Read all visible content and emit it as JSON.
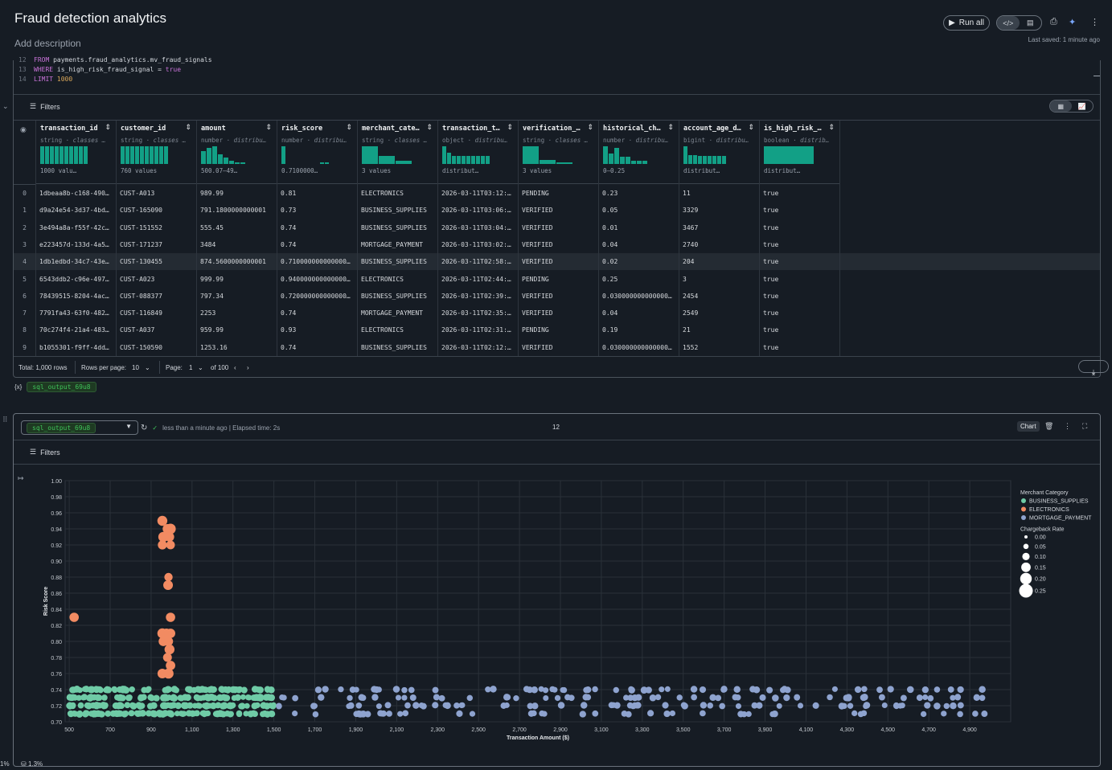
{
  "header": {
    "title": "Fraud detection analytics",
    "description": "Add description",
    "run_all": "Run all",
    "last_saved": "Last saved: 1 minute ago"
  },
  "code": {
    "lines": [
      {
        "n": "12",
        "parts": [
          [
            "kw",
            "FROM "
          ],
          [
            "",
            "payments.fraud_analytics.mv_fraud_signals"
          ]
        ]
      },
      {
        "n": "13",
        "parts": [
          [
            "kw",
            "WHERE "
          ],
          [
            "",
            "is_high_risk_fraud_signal = "
          ],
          [
            "kw",
            "true"
          ]
        ]
      },
      {
        "n": "14",
        "parts": [
          [
            "kw",
            "LIMIT "
          ],
          [
            "str",
            "1000"
          ]
        ]
      }
    ]
  },
  "table": {
    "filters_label": "Filters",
    "columns": [
      {
        "name": "transaction_id",
        "type": "string",
        "sub": "classes …",
        "hist": [
          1,
          1,
          1,
          1,
          1,
          1,
          1,
          1,
          1,
          1
        ],
        "summary": "1000 valu…"
      },
      {
        "name": "customer_id",
        "type": "string",
        "sub": "classes …",
        "hist": [
          1,
          1,
          1,
          1,
          1,
          1,
          1,
          1,
          1,
          1
        ],
        "summary": "760 values"
      },
      {
        "name": "amount",
        "type": "number",
        "sub": "distribu…",
        "hist": [
          0.75,
          0.9,
          1,
          0.55,
          0.35,
          0.2,
          0.1,
          0.1
        ],
        "summary": "500.07–49…"
      },
      {
        "name": "risk_score",
        "type": "number",
        "sub": "distribu…",
        "hist": [
          1,
          0,
          0,
          0,
          0,
          0,
          0,
          0,
          0.05,
          0.05
        ],
        "summary": "0.7100000…"
      },
      {
        "name": "merchant_cate…",
        "type": "string",
        "sub": "classes …",
        "hist": [
          1,
          0.45,
          0.2
        ],
        "summary": "3 values"
      },
      {
        "name": "transaction_t…",
        "type": "object",
        "sub": "distribu…",
        "hist": [
          1,
          0.65,
          0.45,
          0.45,
          0.45,
          0.45,
          0.45,
          0.45,
          0.45,
          0.45
        ],
        "summary": "distribut…"
      },
      {
        "name": "verification_…",
        "type": "string",
        "sub": "classes …",
        "hist": [
          1,
          0.25,
          0.1
        ],
        "summary": "3 values"
      },
      {
        "name": "historical_ch…",
        "type": "number",
        "sub": "distribu…",
        "hist": [
          1,
          0.6,
          0.9,
          0.4,
          0.4,
          0.2,
          0.2,
          0.2
        ],
        "summary": "0–0.25"
      },
      {
        "name": "account_age_d…",
        "type": "bigint",
        "sub": "distribu…",
        "hist": [
          1,
          0.5,
          0.5,
          0.45,
          0.45,
          0.45,
          0.45,
          0.45,
          0.45
        ],
        "summary": "distribut…"
      },
      {
        "name": "is_high_risk_…",
        "type": "boolean",
        "sub": "distrib…",
        "hist": [
          1
        ],
        "summary": "distribut…"
      }
    ],
    "rows": [
      [
        "0",
        "1dbeaa8b-c168-490…",
        "CUST-A013",
        "989.99",
        "0.81",
        "ELECTRONICS",
        "2026-03-11T03:12:…",
        "PENDING",
        "0.23",
        "11",
        "true"
      ],
      [
        "1",
        "d9a24e54-3d37-4bd…",
        "CUST-165090",
        "791.1800000000001",
        "0.73",
        "BUSINESS_SUPPLIES",
        "2026-03-11T03:06:…",
        "VERIFIED",
        "0.05",
        "3329",
        "true"
      ],
      [
        "2",
        "3e494a8a-f55f-42c…",
        "CUST-151552",
        "555.45",
        "0.74",
        "BUSINESS_SUPPLIES",
        "2026-03-11T03:04:…",
        "VERIFIED",
        "0.01",
        "3467",
        "true"
      ],
      [
        "3",
        "e223457d-133d-4a5…",
        "CUST-171237",
        "3484",
        "0.74",
        "MORTGAGE_PAYMENT",
        "2026-03-11T03:02:…",
        "VERIFIED",
        "0.04",
        "2740",
        "true"
      ],
      [
        "4",
        "1db1edbd-34c7-43e…",
        "CUST-130455",
        "874.5600000000001",
        "0.710000000000000…",
        "BUSINESS_SUPPLIES",
        "2026-03-11T02:58:…",
        "VERIFIED",
        "0.02",
        "204",
        "true"
      ],
      [
        "5",
        "6543ddb2-c96e-497…",
        "CUST-A023",
        "999.99",
        "0.940000000000000…",
        "ELECTRONICS",
        "2026-03-11T02:44:…",
        "PENDING",
        "0.25",
        "3",
        "true"
      ],
      [
        "6",
        "78439515-8204-4ac…",
        "CUST-088377",
        "797.34",
        "0.720000000000000…",
        "BUSINESS_SUPPLIES",
        "2026-03-11T02:39:…",
        "VERIFIED",
        "0.030000000000000…",
        "2454",
        "true"
      ],
      [
        "7",
        "7791fa43-63f0-482…",
        "CUST-116849",
        "2253",
        "0.74",
        "MORTGAGE_PAYMENT",
        "2026-03-11T02:35:…",
        "VERIFIED",
        "0.04",
        "2549",
        "true"
      ],
      [
        "8",
        "70c274f4-21a4-483…",
        "CUST-A037",
        "959.99",
        "0.93",
        "ELECTRONICS",
        "2026-03-11T02:31:…",
        "PENDING",
        "0.19",
        "21",
        "true"
      ],
      [
        "9",
        "b1055301-f9ff-4dd…",
        "CUST-150590",
        "1253.16",
        "0.74",
        "BUSINESS_SUPPLIES",
        "2026-03-11T02:12:…",
        "VERIFIED",
        "0.030000000000000…",
        "1552",
        "true"
      ]
    ],
    "pager": {
      "total": "Total: 1,000 rows",
      "rows_per_page_label": "Rows per page:",
      "rows_per_page": "10",
      "page_label": "Page:",
      "page": "1",
      "of": "of 100"
    },
    "output_var": "sql_output_69u8"
  },
  "chart_cell": {
    "source": "sql_output_69u8",
    "status": "less than a minute ago | Elapsed time: 2s",
    "count": "12",
    "chart_btn": "Chart",
    "filters_label": "Filters"
  },
  "chart_data": {
    "type": "scatter",
    "xlabel": "Transaction Amount ($)",
    "ylabel": "Risk Score",
    "xlim": [
      480,
      5100
    ],
    "ylim": [
      0.7,
      1.0
    ],
    "xticks": [
      500,
      700,
      900,
      1100,
      1300,
      1500,
      1700,
      1900,
      2100,
      2300,
      2500,
      2700,
      2900,
      3100,
      3300,
      3500,
      3700,
      3900,
      4100,
      4300,
      4500,
      4700,
      4900
    ],
    "yticks": [
      0.7,
      0.72,
      0.74,
      0.76,
      0.78,
      0.8,
      0.82,
      0.84,
      0.86,
      0.88,
      0.9,
      0.92,
      0.94,
      0.96,
      0.98,
      1.0
    ],
    "grid": true,
    "legend": {
      "title": "Merchant Category",
      "placement": "right",
      "items": [
        {
          "name": "BUSINESS_SUPPLIES",
          "color": "#6fcba6"
        },
        {
          "name": "ELECTRONICS",
          "color": "#f28b62"
        },
        {
          "name": "MORTGAGE_PAYMENT",
          "color": "#8ea3cf"
        }
      ]
    },
    "size_legend": {
      "title": "Chargeback Rate",
      "values": [
        "0.00",
        "0.05",
        "0.10",
        "0.15",
        "0.20",
        "0.25"
      ]
    },
    "series": [
      {
        "name": "ELECTRONICS",
        "color": "#f28b62",
        "points": [
          [
            524,
            0.83,
            0.18
          ],
          [
            955,
            0.95,
            0.22
          ],
          [
            995,
            0.94,
            0.25
          ],
          [
            980,
            0.94,
            0.2
          ],
          [
            960,
            0.93,
            0.23
          ],
          [
            990,
            0.93,
            0.18
          ],
          [
            955,
            0.92,
            0.16
          ],
          [
            995,
            0.92,
            0.14
          ],
          [
            985,
            0.88,
            0.12
          ],
          [
            983,
            0.87,
            0.2
          ],
          [
            995,
            0.83,
            0.18
          ],
          [
            955,
            0.81,
            0.22
          ],
          [
            975,
            0.81,
            0.2
          ],
          [
            995,
            0.81,
            0.19
          ],
          [
            960,
            0.8,
            0.19
          ],
          [
            985,
            0.8,
            0.17
          ],
          [
            990,
            0.79,
            0.22
          ],
          [
            980,
            0.78,
            0.15
          ],
          [
            995,
            0.77,
            0.19
          ],
          [
            955,
            0.76,
            0.2
          ],
          [
            985,
            0.76,
            0.23
          ]
        ]
      },
      {
        "name": "BUSINESS_SUPPLIES",
        "color": "#6fcba6",
        "gen": {
          "xmin": 500,
          "xmax": 1500,
          "ys": [
            0.71,
            0.72,
            0.73,
            0.74
          ],
          "n": [
            34,
            34,
            34,
            30
          ],
          "r": 3.5
        }
      },
      {
        "name": "MORTGAGE_PAYMENT",
        "color": "#8ea3cf",
        "gen": {
          "xmin": 1500,
          "xmax": 5000,
          "ys": [
            0.71,
            0.72,
            0.73,
            0.74
          ],
          "n": [
            30,
            36,
            34,
            32
          ],
          "r": 3.5
        }
      }
    ]
  },
  "footer": {
    "left": "1%",
    "mem": "1.3%"
  }
}
